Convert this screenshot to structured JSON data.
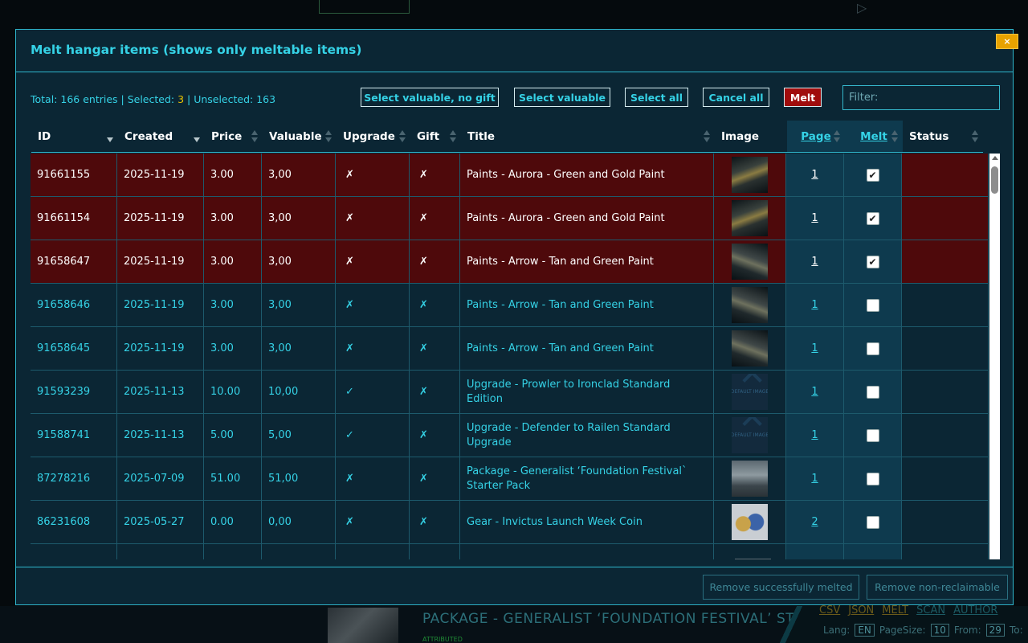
{
  "dialog": {
    "title": "Melt hangar items (shows only meltable items)",
    "close_label": "×"
  },
  "summary": {
    "prefix": "Total: 166 entries | Selected: ",
    "selected": "3",
    "suffix": " | Unselected: 163"
  },
  "toolbar": {
    "select_valuable_no_gift": "Select valuable, no gift",
    "select_valuable": "Select valuable",
    "select_all": "Select all",
    "cancel_all": "Cancel all",
    "melt": "Melt",
    "filter_placeholder": "Filter:"
  },
  "columns": {
    "id": "ID",
    "created": "Created",
    "price": "Price",
    "valuable": "Valuable",
    "upgrade": "Upgrade",
    "gift": "Gift",
    "title": "Title",
    "image": "Image",
    "page": "Page",
    "melt": "Melt",
    "status": "Status"
  },
  "rows": [
    {
      "id": "91661155",
      "created": "2025-11-19",
      "price": "3.00",
      "valuable": "3,00",
      "upgrade": "✗",
      "gift": "✗",
      "title": "Paints - Aurora - Green and Gold Paint",
      "image": "ship1",
      "page": "1",
      "checked": true
    },
    {
      "id": "91661154",
      "created": "2025-11-19",
      "price": "3.00",
      "valuable": "3,00",
      "upgrade": "✗",
      "gift": "✗",
      "title": "Paints - Aurora - Green and Gold Paint",
      "image": "ship1",
      "page": "1",
      "checked": true
    },
    {
      "id": "91658647",
      "created": "2025-11-19",
      "price": "3.00",
      "valuable": "3,00",
      "upgrade": "✗",
      "gift": "✗",
      "title": "Paints - Arrow - Tan and Green Paint",
      "image": "ship2",
      "page": "1",
      "checked": true
    },
    {
      "id": "91658646",
      "created": "2025-11-19",
      "price": "3.00",
      "valuable": "3,00",
      "upgrade": "✗",
      "gift": "✗",
      "title": "Paints - Arrow - Tan and Green Paint",
      "image": "ship2",
      "page": "1",
      "checked": false
    },
    {
      "id": "91658645",
      "created": "2025-11-19",
      "price": "3.00",
      "valuable": "3,00",
      "upgrade": "✗",
      "gift": "✗",
      "title": "Paints - Arrow - Tan and Green Paint",
      "image": "ship2",
      "page": "1",
      "checked": false
    },
    {
      "id": "91593239",
      "created": "2025-11-13",
      "price": "10.00",
      "valuable": "10,00",
      "upgrade": "✓",
      "gift": "✗",
      "title": "Upgrade - Prowler to Ironclad Standard Edition",
      "image": "default",
      "page": "1",
      "checked": false
    },
    {
      "id": "91588741",
      "created": "2025-11-13",
      "price": "5.00",
      "valuable": "5,00",
      "upgrade": "✓",
      "gift": "✗",
      "title": "Upgrade - Defender to Railen Standard Upgrade",
      "image": "default",
      "page": "1",
      "checked": false
    },
    {
      "id": "87278216",
      "created": "2025-07-09",
      "price": "51.00",
      "valuable": "51,00",
      "upgrade": "✗",
      "gift": "✗",
      "title": "Package - Generalist ‘Foundation Festival` Starter Pack",
      "image": "pack",
      "page": "1",
      "checked": false
    },
    {
      "id": "86231608",
      "created": "2025-05-27",
      "price": "0.00",
      "valuable": "0,00",
      "upgrade": "✗",
      "gift": "✗",
      "title": "Gear - Invictus Launch Week Coin",
      "image": "coin",
      "page": "2",
      "checked": false
    }
  ],
  "default_image_text": "DEFAULT IMAGE",
  "footer": {
    "remove_melted": "Remove successfully melted",
    "remove_non_reclaimable": "Remove non-reclaimable"
  },
  "background": {
    "package_title": "PACKAGE - GENERALIST ‘FOUNDATION FESTIVAL’ STA",
    "attributed": "ATTRIBUTED",
    "links": [
      "CSV",
      "JSON",
      "MELT",
      "SCAN",
      "AUTHOR"
    ],
    "lang_label": "Lang:",
    "lang_value": "EN",
    "pagesize_label": "PageSize:",
    "pagesize_value": "10",
    "from_label": "From:",
    "from_value": "29",
    "to_label": "To:"
  }
}
